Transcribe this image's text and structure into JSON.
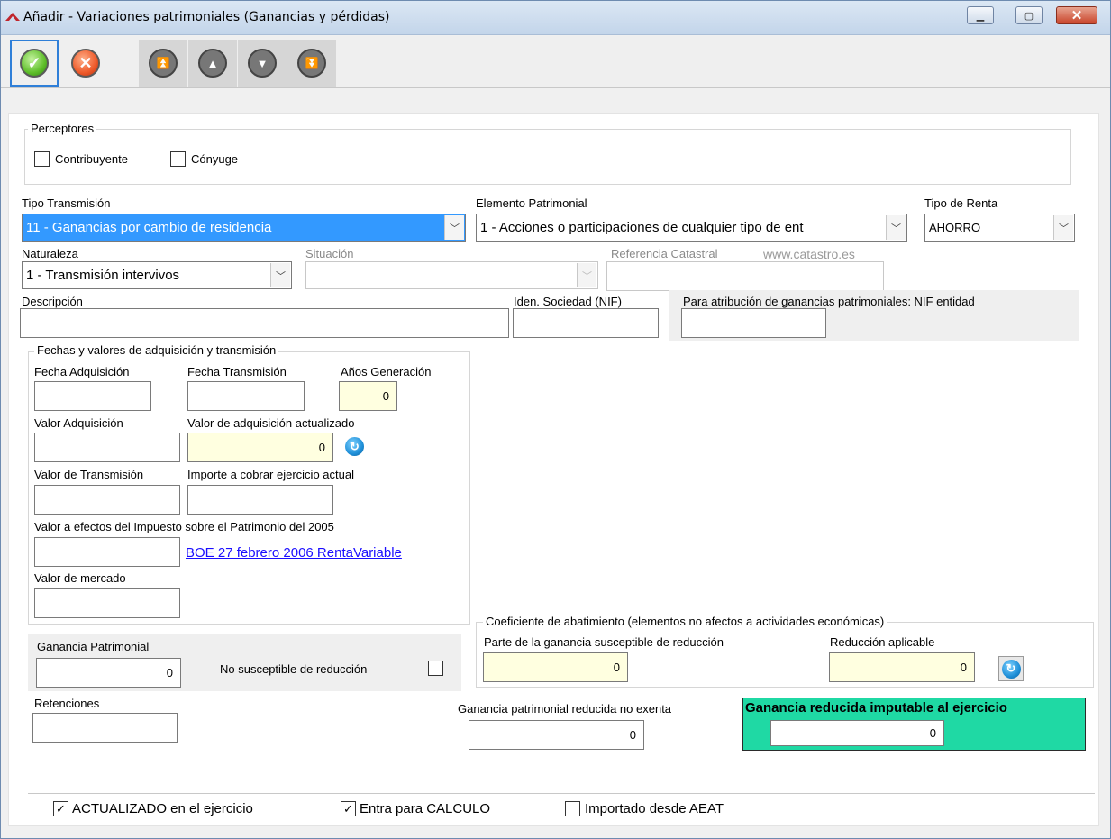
{
  "window": {
    "title": "Añadir  - Variaciones patrimoniales (Ganancias y pérdidas)",
    "minimize": "▁",
    "maximize": "▢",
    "close": "✕"
  },
  "toolbar": {
    "accept": "✓",
    "cancel": "✕",
    "first": "⏫",
    "prev": "▲",
    "next": "▼",
    "last": "⏬"
  },
  "perceptores": {
    "legend": "Perceptores",
    "contribuyente": {
      "label": "Contribuyente",
      "checked": false
    },
    "conyuge": {
      "label": "Cónyuge",
      "checked": false
    }
  },
  "tipo_transmision": {
    "label": "Tipo Transmisión",
    "value": "11 - Ganancias por cambio de residencia"
  },
  "elemento_patrimonial": {
    "label": "Elemento Patrimonial",
    "value": "1 - Acciones o participaciones de cualquier tipo de ent"
  },
  "tipo_renta": {
    "label": "Tipo de Renta",
    "value": "AHORRO"
  },
  "naturaleza": {
    "label": "Naturaleza",
    "value": "1 - Transmisión intervivos"
  },
  "situacion": {
    "label": "Situación",
    "value": ""
  },
  "referencia_catastral": {
    "label": "Referencia Catastral",
    "link": "www.catastro.es",
    "value": ""
  },
  "descripcion": {
    "label": "Descripción",
    "value": ""
  },
  "iden_sociedad": {
    "label": "Iden. Sociedad (NIF)",
    "value": ""
  },
  "atribucion": {
    "label": "Para atribución de ganancias patrimoniales: NIF entidad",
    "value": ""
  },
  "fechas": {
    "legend": "Fechas y valores de adquisición y transmisión",
    "fecha_adquisicion": {
      "label": "Fecha Adquisición",
      "value": ""
    },
    "fecha_transmision": {
      "label": "Fecha Transmisión",
      "value": ""
    },
    "anos_generacion": {
      "label": "Años Generación",
      "value": "0"
    },
    "valor_adquisicion": {
      "label": "Valor Adquisición",
      "value": ""
    },
    "valor_adq_actualizado": {
      "label": "Valor de adquisición actualizado",
      "value": "0"
    },
    "valor_transmision": {
      "label": "Valor de Transmisión",
      "value": ""
    },
    "importe_cobrar": {
      "label": "Importe a cobrar ejercicio actual",
      "value": ""
    },
    "valor_patrimonio": {
      "label": "Valor a efectos del Impuesto sobre el Patrimonio del 2005",
      "value": ""
    },
    "boe_link": "BOE 27 febrero 2006 RentaVariable",
    "valor_mercado": {
      "label": "Valor de mercado",
      "value": ""
    }
  },
  "coeficiente": {
    "legend": "Coeficiente de abatimiento (elementos no afectos a actividades económicas)",
    "parte_ganancia": {
      "label": "Parte de la ganancia susceptible de reducción",
      "value": "0"
    },
    "reduccion": {
      "label": "Reducción aplicable",
      "value": "0"
    }
  },
  "ganancia_patrimonial": {
    "label": "Ganancia Patrimonial",
    "value": "0"
  },
  "no_susceptible": {
    "label": "No susceptible de reducción",
    "checked": false
  },
  "retenciones": {
    "label": "Retenciones",
    "value": ""
  },
  "ganancia_reducida_no_exenta": {
    "label": "Ganancia patrimonial reducida no exenta",
    "value": "0"
  },
  "ganancia_imputable": {
    "label": "Ganancia reducida imputable al ejercicio",
    "value": "0"
  },
  "footer": {
    "actualizado": {
      "label": "ACTUALIZADO en el ejercicio",
      "checked": true,
      "mark": "✓"
    },
    "calculo": {
      "label": "Entra para CALCULO",
      "checked": true,
      "mark": "✓"
    },
    "importado": {
      "label": "Importado desde AEAT",
      "checked": false,
      "mark": ""
    }
  },
  "colors": {
    "highlight": "#3399ff",
    "readonly_yellow": "#ffffe0",
    "imputable_green": "#1fd9a4",
    "link": "#1a0dff"
  }
}
